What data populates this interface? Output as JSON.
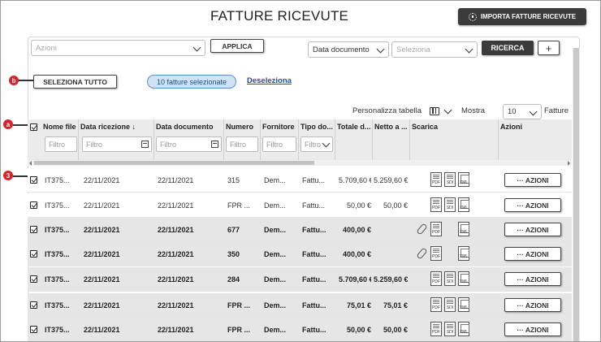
{
  "title": "FATTURE RICEVUTE",
  "import_button": "IMPORTA FATTURE RICEVUTE",
  "toolbar": {
    "azioni_placeholder": "Azioni",
    "applica": "APPLICA",
    "date_select": "Data documento",
    "seleziona_placeholder": "Seleziona",
    "ricerca": "RICERCA",
    "add": "+"
  },
  "selection": {
    "select_all": "SELEZIONA TUTTO",
    "selected_pill": "10 fatture selezionate",
    "deselect_link": "Deseleziona"
  },
  "markers": {
    "a": "a",
    "b": "b",
    "three": "3"
  },
  "table_settings": {
    "personalizza": "Personalizza tabella",
    "mostra": "Mostra",
    "page_size": "10",
    "fatture": "Fatture"
  },
  "columns": {
    "nome_file": "Nome file",
    "data_ricezione": "Data ricezione ↓",
    "data_documento": "Data documento",
    "numero": "Numero",
    "fornitore": "Fornitore",
    "tipo": "Tipo do...",
    "totale": "Totale d...",
    "netto": "Netto a ...",
    "scarica": "Scarica",
    "azioni": "Azioni"
  },
  "filter_placeholder": "Filtro",
  "file_labels": {
    "pdf": "PDF",
    "sdi": "SDI",
    "xml": "XML"
  },
  "action_label": "··· AZIONI",
  "rows": [
    {
      "nome": "IT375...",
      "ricezione": "22/11/2021",
      "documento": "22/11/2021",
      "numero": "315",
      "fornitore": "Dem...",
      "tipo": "Fattu...",
      "totale": "5.709,60 €",
      "netto": "5.259,60 €",
      "clip": false
    },
    {
      "nome": "IT375...",
      "ricezione": "22/11/2021",
      "documento": "22/11/2021",
      "numero": "FPR ...",
      "fornitore": "Dem...",
      "tipo": "Fattu...",
      "totale": "50,00 €",
      "netto": "50,00 €",
      "clip": false
    },
    {
      "nome": "IT375...",
      "ricezione": "22/11/2021",
      "documento": "22/11/2021",
      "numero": "677",
      "fornitore": "Dem...",
      "tipo": "Fattu...",
      "totale": "400,00 €",
      "netto": "",
      "clip": true
    },
    {
      "nome": "IT375...",
      "ricezione": "22/11/2021",
      "documento": "22/11/2021",
      "numero": "350",
      "fornitore": "Dem...",
      "tipo": "Fattu...",
      "totale": "400,00 €",
      "netto": "",
      "clip": true
    },
    {
      "nome": "IT375...",
      "ricezione": "22/11/2021",
      "documento": "22/11/2021",
      "numero": "284",
      "fornitore": "Dem...",
      "tipo": "Fattu...",
      "totale": "5.709,60 €",
      "netto": "5.259,60 €",
      "clip": false
    },
    {
      "nome": "IT375...",
      "ricezione": "22/11/2021",
      "documento": "22/11/2021",
      "numero": "FPR ...",
      "fornitore": "Dem...",
      "tipo": "Fattu...",
      "totale": "75,01 €",
      "netto": "75,01 €",
      "clip": false
    },
    {
      "nome": "IT375...",
      "ricezione": "22/11/2021",
      "documento": "22/11/2021",
      "numero": "FPR ...",
      "fornitore": "Dem...",
      "tipo": "Fattu...",
      "totale": "50,00 €",
      "netto": "50,00 €",
      "clip": false
    }
  ]
}
